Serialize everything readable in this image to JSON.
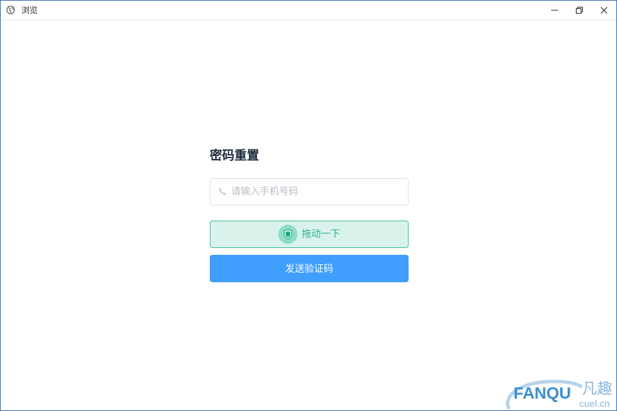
{
  "window": {
    "title": "浏览",
    "icon": "globe-icon"
  },
  "form": {
    "title": "密码重置",
    "phone_placeholder": "请输入手机号码",
    "phone_value": "",
    "slider_text": "拖动一下",
    "send_label": "发送验证码"
  },
  "watermark": {
    "latin": "FANQU",
    "cjk": "凡趣",
    "domain": "cuel.cn"
  },
  "colors": {
    "primary": "#409eff",
    "slider_border": "#3cc0a0",
    "slider_bg": "#d9f3ec",
    "slider_text": "#2bb38f",
    "window_border": "#3c6fb0"
  }
}
